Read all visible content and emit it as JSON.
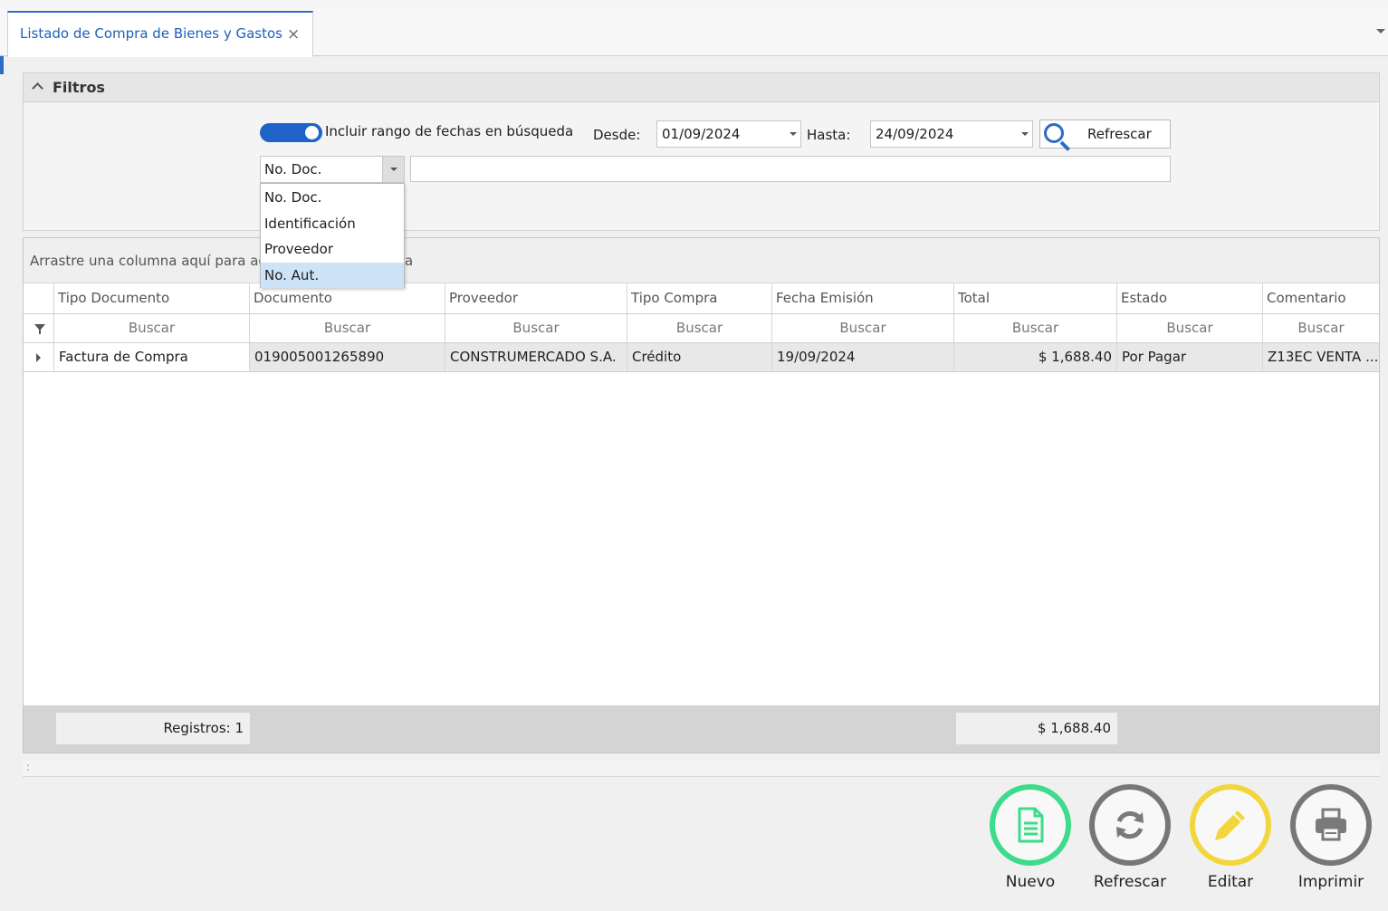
{
  "tab": {
    "title": "Listado de Compra de Bienes y Gastos",
    "close": "×"
  },
  "filters": {
    "title": "Filtros",
    "toggle_label": "Incluir rango de fechas en búsqueda",
    "desde_label": "Desde:",
    "desde_value": "01/09/2024",
    "hasta_label": "Hasta:",
    "hasta_value": "24/09/2024",
    "refresh_label": "Refrescar",
    "search_field": "No. Doc.",
    "search_value": "",
    "options": [
      "No. Doc.",
      "Identificación",
      "Proveedor",
      "No. Aut."
    ],
    "selected_option": "No. Aut."
  },
  "grid": {
    "group_text": "Arrastre una columna aquí para agr",
    "group_text_tail": "a",
    "columns": [
      "Tipo Documento",
      "Documento",
      "Proveedor",
      "Tipo Compra",
      "Fecha Emisión",
      "Total",
      "Estado",
      "Comentario"
    ],
    "filter_placeholder": "Buscar",
    "rows": [
      [
        "Factura de Compra",
        "019005001265890",
        "CONSTRUMERCADO S.A.",
        "Crédito",
        "19/09/2024",
        "$ 1,688.40",
        "Por Pagar",
        "Z13EC VENTA ..."
      ]
    ],
    "footer_count": "Registros: 1",
    "footer_total": "$ 1,688.40"
  },
  "splitter_mark": ":",
  "actions": [
    {
      "label": "Nuevo",
      "icon": "document-icon",
      "color": "#3ddc8a"
    },
    {
      "label": "Refrescar",
      "icon": "refresh-icon",
      "color": "#7a7a7a"
    },
    {
      "label": "Editar",
      "icon": "pencil-icon",
      "color": "#f2d63c"
    },
    {
      "label": "Imprimir",
      "icon": "printer-icon",
      "color": "#7a7a7a"
    }
  ]
}
